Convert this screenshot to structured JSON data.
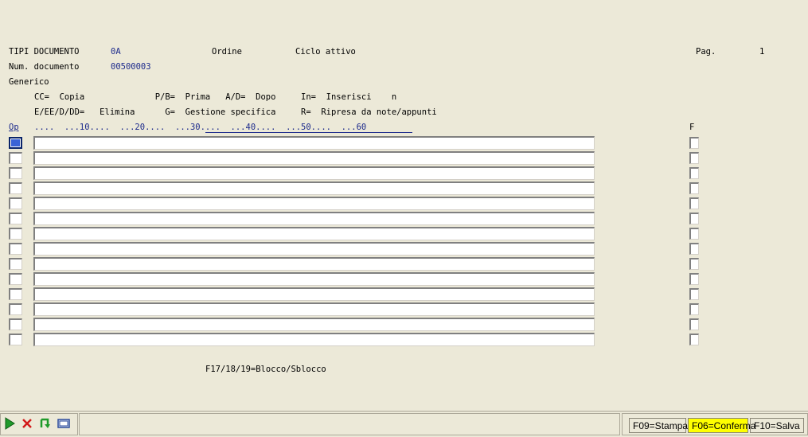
{
  "header": {
    "tipi_documento_label": "TIPI DOCUMENTO",
    "tipi_documento_value": "0A",
    "ordine_label": "Ordine",
    "ciclo_label": "Ciclo attivo",
    "pag_label": "Pag.",
    "pag_value": "1",
    "num_documento_label": "Num. documento",
    "num_documento_value": "00500003",
    "generico_label": "Generico"
  },
  "legend": {
    "row1": "CC=  Copia              P/B=  Prima   A/D=  Dopo     In=  Inserisci    n",
    "row2": "E/EE/D/DD=   Elimina      G=  Gestione specifica     R=  Ripresa da note/appunti"
  },
  "grid": {
    "op_header": "Op",
    "ruler": "....  ...10....  ...20....  ...30....  ...40....  ...50....  ...60",
    "f_header": "F",
    "row_count": 14
  },
  "footer_hint": "F17/18/19=Blocco/Sblocco",
  "toolbar": {
    "icons": [
      "play-icon",
      "cancel-icon",
      "refresh-icon",
      "window-icon"
    ]
  },
  "function_keys": {
    "stampa": "F09=Stampa",
    "conferma": "F06=Conferma",
    "salva": "F10=Salva"
  },
  "colors": {
    "accent": "#1c2a8c",
    "highlight": "#ffff00",
    "background": "#ece9d8"
  }
}
